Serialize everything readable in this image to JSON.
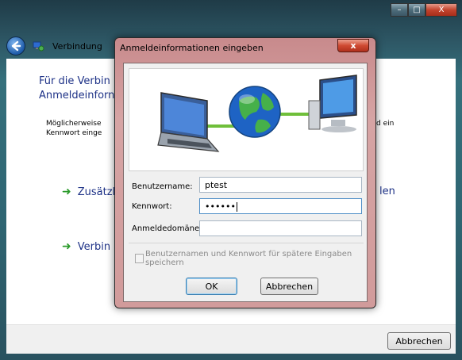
{
  "background_window": {
    "title": "Verbindung",
    "heading": "Für die Verbindung Anmeldeinformationen",
    "heading_line1": "Für die Verbin",
    "heading_line2": "Anmeldeinforn",
    "description_line1": "Möglicherweise",
    "description_line2": "Kennwort einge",
    "description_right": "d ein",
    "options": [
      {
        "label": "Zusätzl",
        "right": "len"
      },
      {
        "label": "Verbin"
      }
    ],
    "cancel_label": "Abbrechen",
    "caption_buttons": [
      "minimize",
      "maximize",
      "close"
    ]
  },
  "dialog": {
    "title": "Anmeldeinformationen eingeben",
    "close_label": "x",
    "fields": {
      "username": {
        "label": "Benutzername:",
        "value": "ptest"
      },
      "password": {
        "label": "Kennwort:",
        "value": "••••••"
      },
      "domain": {
        "label": "Anmeldedomäne:",
        "value": ""
      }
    },
    "save_checkbox_label": "Benutzernamen und Kennwort für spätere Eingaben speichern",
    "save_checked": false,
    "ok_label": "OK",
    "cancel_label": "Abbrechen"
  },
  "colors": {
    "accent_link": "#1e3287",
    "arrow_green": "#2a9a2a",
    "dialog_frame": "#d19b9b"
  },
  "icons": {
    "back": "back-arrow-icon",
    "network_illustration": "laptop-globe-computer-icon",
    "arrow": "green-arrow-icon"
  }
}
